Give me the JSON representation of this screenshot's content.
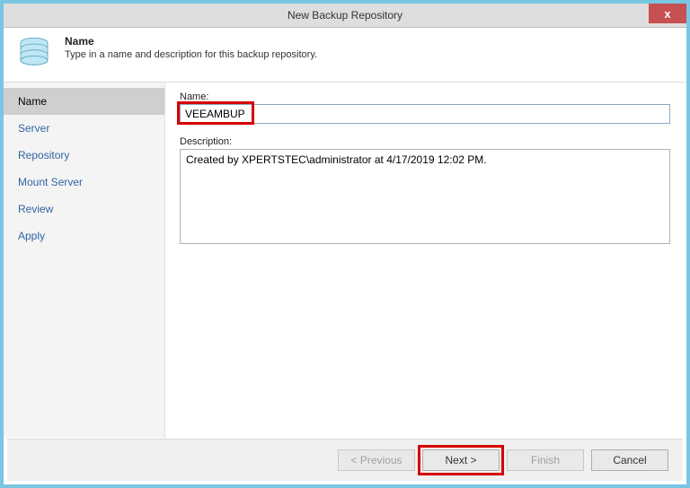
{
  "window": {
    "title": "New Backup Repository",
    "close": "x"
  },
  "header": {
    "title": "Name",
    "subtitle": "Type in a name and description for this backup repository."
  },
  "sidebar": {
    "items": [
      {
        "label": "Name",
        "active": true
      },
      {
        "label": "Server",
        "active": false
      },
      {
        "label": "Repository",
        "active": false
      },
      {
        "label": "Mount Server",
        "active": false
      },
      {
        "label": "Review",
        "active": false
      },
      {
        "label": "Apply",
        "active": false
      }
    ]
  },
  "form": {
    "name_label": "Name:",
    "name_value": "VEEAMBUP",
    "description_label": "Description:",
    "description_value": "Created by XPERTSTEC\\administrator at 4/17/2019 12:02 PM."
  },
  "buttons": {
    "previous": "< Previous",
    "next": "Next >",
    "finish": "Finish",
    "cancel": "Cancel"
  },
  "colors": {
    "frame": "#79c6e3",
    "highlight": "#d60000",
    "close_bg": "#c75050"
  }
}
